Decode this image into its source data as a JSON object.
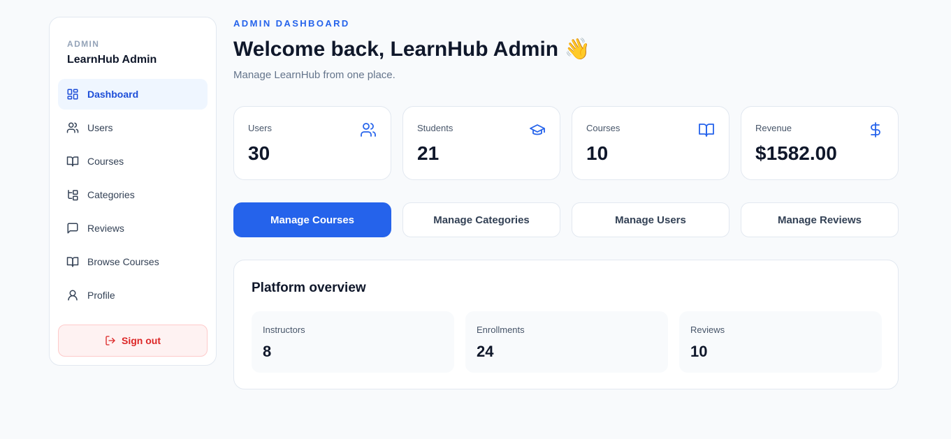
{
  "sidebar": {
    "role": "ADMIN",
    "brand": "LearnHub Admin",
    "items": [
      {
        "label": "Dashboard",
        "icon": "dashboard-icon",
        "active": true
      },
      {
        "label": "Users",
        "icon": "users-icon"
      },
      {
        "label": "Courses",
        "icon": "book-icon"
      },
      {
        "label": "Categories",
        "icon": "folder-tree-icon"
      },
      {
        "label": "Reviews",
        "icon": "message-square-icon"
      },
      {
        "label": "Browse Courses",
        "icon": "book-icon"
      },
      {
        "label": "Profile",
        "icon": "user-icon"
      }
    ],
    "signout_label": "Sign out"
  },
  "header": {
    "eyebrow": "ADMIN DASHBOARD",
    "title": "Welcome back, LearnHub Admin 👋",
    "subtitle": "Manage LearnHub from one place."
  },
  "stats": [
    {
      "label": "Users",
      "value": "30",
      "icon": "users-icon"
    },
    {
      "label": "Students",
      "value": "21",
      "icon": "graduation-cap-icon"
    },
    {
      "label": "Courses",
      "value": "10",
      "icon": "book-icon"
    },
    {
      "label": "Revenue",
      "value": "$1582.00",
      "icon": "dollar-icon"
    }
  ],
  "actions": [
    {
      "label": "Manage Courses",
      "primary": true
    },
    {
      "label": "Manage Categories"
    },
    {
      "label": "Manage Users"
    },
    {
      "label": "Manage Reviews"
    }
  ],
  "overview": {
    "heading": "Platform overview",
    "cards": [
      {
        "label": "Instructors",
        "value": "8"
      },
      {
        "label": "Enrollments",
        "value": "24"
      },
      {
        "label": "Reviews",
        "value": "10"
      }
    ]
  },
  "colors": {
    "accent": "#2563eb",
    "active_nav_bg": "#eff6ff",
    "danger": "#dc2626",
    "danger_bg": "#fef2f2"
  }
}
